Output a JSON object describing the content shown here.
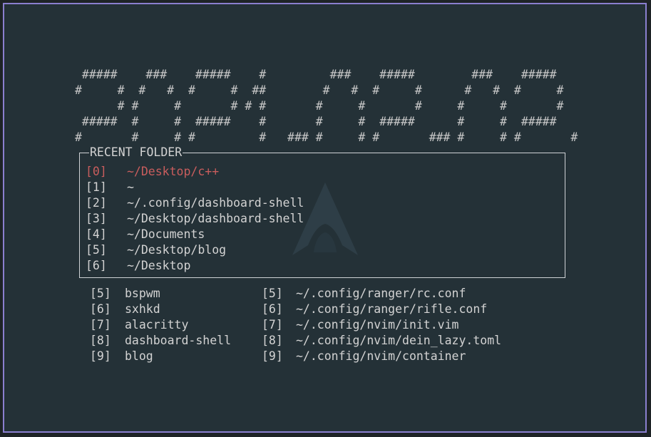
{
  "banner": {
    "lines": [
      " #####    ###    #####    #         ###    #####        ###    #####",
      "#     #  #   #  #     #  ##        #   #  #     #      #   #  #     #",
      "      # #     #       # # #       #     #       #     #     #       #",
      " #####  #     #  #####    #       #     #  #####      #     #  #####",
      "#       #     # #         #   ### #     # #       ### #     # #       #"
    ]
  },
  "recent": {
    "title": "RECENT FOLDER",
    "items": [
      {
        "index": "[0]",
        "path": "~/Desktop/c++",
        "active": true
      },
      {
        "index": "[1]",
        "path": "~",
        "active": false
      },
      {
        "index": "[2]",
        "path": "~/.config/dashboard-shell",
        "active": false
      },
      {
        "index": "[3]",
        "path": "~/Desktop/dashboard-shell",
        "active": false
      },
      {
        "index": "[4]",
        "path": "~/Documents",
        "active": false
      },
      {
        "index": "[5]",
        "path": "~/Desktop/blog",
        "active": false
      },
      {
        "index": "[6]",
        "path": "~/Desktop",
        "active": false
      }
    ]
  },
  "bookmarks_left": [
    {
      "index": "[5]",
      "label": "bspwm"
    },
    {
      "index": "[6]",
      "label": "sxhkd"
    },
    {
      "index": "[7]",
      "label": "alacritty"
    },
    {
      "index": "[8]",
      "label": "dashboard-shell"
    },
    {
      "index": "[9]",
      "label": "blog"
    }
  ],
  "bookmarks_right": [
    {
      "index": "[5]",
      "label": "~/.config/ranger/rc.conf"
    },
    {
      "index": "[6]",
      "label": "~/.config/ranger/rifle.conf"
    },
    {
      "index": "[7]",
      "label": "~/.config/nvim/init.vim"
    },
    {
      "index": "[8]",
      "label": "~/.config/nvim/dein_lazy.toml"
    },
    {
      "index": "[9]",
      "label": "~/.config/nvim/container"
    }
  ],
  "colors": {
    "background": "#243137",
    "border": "#8a7fcf",
    "text": "#d3d3d3",
    "active": "#c95d5d"
  },
  "icons": {
    "watermark": "arch-logo-icon"
  }
}
